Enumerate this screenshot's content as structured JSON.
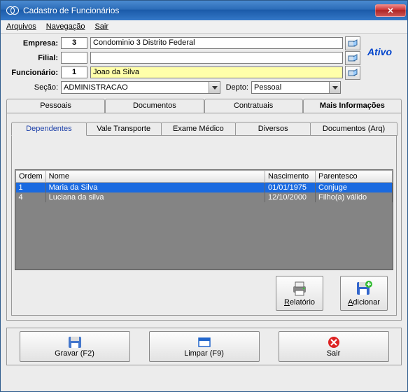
{
  "window": {
    "title": "Cadastro de Funcionários"
  },
  "menu": {
    "arquivos": "Arquivos",
    "navegacao": "Navegação",
    "sair": "Sair"
  },
  "form": {
    "empresa_label": "Empresa:",
    "empresa_num": "3",
    "empresa_nome": "Condominio 3 Distrito Federal",
    "filial_label": "Filial:",
    "filial_num": "",
    "filial_nome": "",
    "func_label": "Funcionário:",
    "func_num": "1",
    "func_nome": "Joao da Silva",
    "secao_label": "Seção:",
    "secao_value": "ADMINISTRACAO",
    "depto_label": "Depto:",
    "depto_value": "Pessoal",
    "status": "Ativo"
  },
  "outer_tabs": {
    "pessoais": "Pessoais",
    "documentos": "Documentos",
    "contratuais": "Contratuais",
    "mais": "Mais Informações"
  },
  "inner_tabs": {
    "dependentes": "Dependentes",
    "vale": "Vale Transporte",
    "exame": "Exame Médico",
    "diversos": "Diversos",
    "docs_arq": "Documentos (Arq)"
  },
  "grid": {
    "headers": {
      "ordem": "Ordem",
      "nome": "Nome",
      "nascimento": "Nascimento",
      "parentesco": "Parentesco"
    },
    "rows": [
      {
        "ordem": "1",
        "nome": "Maria da Silva",
        "nasc": "01/01/1975",
        "parent": "Conjuge"
      },
      {
        "ordem": "4",
        "nome": "Luciana da silva",
        "nasc": "12/10/2000",
        "parent": "Filho(a) válido"
      }
    ]
  },
  "buttons": {
    "relatorio": "Relatório",
    "adicionar": "Adicionar",
    "gravar": "Gravar (F2)",
    "limpar": "Limpar (F9)",
    "sair": "Sair"
  }
}
